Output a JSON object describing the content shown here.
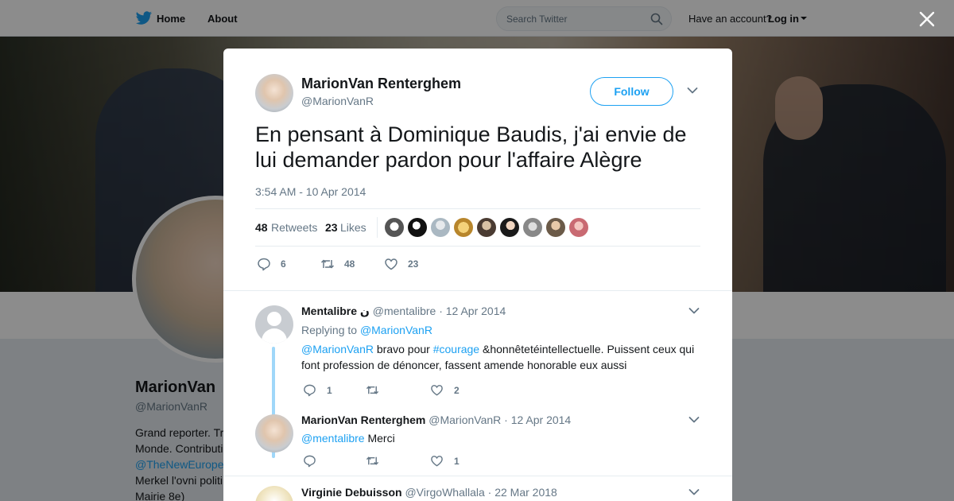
{
  "nav": {
    "home": "Home",
    "about": "About",
    "search_placeholder": "Search Twitter",
    "have_account": "Have an account?",
    "login": "Log in"
  },
  "profile": {
    "name": "MarionVan",
    "handle": "@MarionVanR",
    "bio_line1": "Grand reporter. Tr",
    "bio_line2": "Monde. Contributi",
    "bio_link": "@TheNewEurope",
    "bio_line4": "Merkel l'ovni politi",
    "bio_line5": "Mairie 8e)"
  },
  "tweet": {
    "author_name": "MarionVan Renterghem",
    "author_handle": "@MarionVanR",
    "follow_label": "Follow",
    "text": "En pensant à Dominique Baudis, j'ai envie de lui demander pardon pour l'affaire Alègre",
    "timestamp": "3:54 AM - 10 Apr 2014",
    "retweets_count": "48",
    "retweets_label": "Retweets",
    "likes_count": "23",
    "likes_label": "Likes",
    "reply_count": "6",
    "retweet_count": "48",
    "like_count": "23"
  },
  "replies": [
    {
      "name": "Mentalibre ن",
      "handle": "@mentalibre",
      "date": "· 12 Apr 2014",
      "replying_prefix": "Replying to",
      "replying_to": "@MarionVanR",
      "mention": "@MarionVanR",
      "text_a": " bravo pour ",
      "hashtag": "#courage",
      "text_b": " &honnêtetéintellectuelle. Puissent ceux qui font profession de dénoncer,  fassent amende honorable eux aussi",
      "reply_count": "1",
      "like_count": "2"
    },
    {
      "name": "MarionVan Renterghem",
      "handle": "@MarionVanR",
      "date": "· 12 Apr 2014",
      "mention": "@mentalibre",
      "text": " Merci",
      "like_count": "1"
    },
    {
      "name": "Virginie Debuisson",
      "handle": "@VirgoWhallala",
      "date": "· 22 Mar 2018"
    }
  ],
  "colors": {
    "accent": "#1da1f2",
    "text": "#14171a",
    "muted": "#657786"
  }
}
